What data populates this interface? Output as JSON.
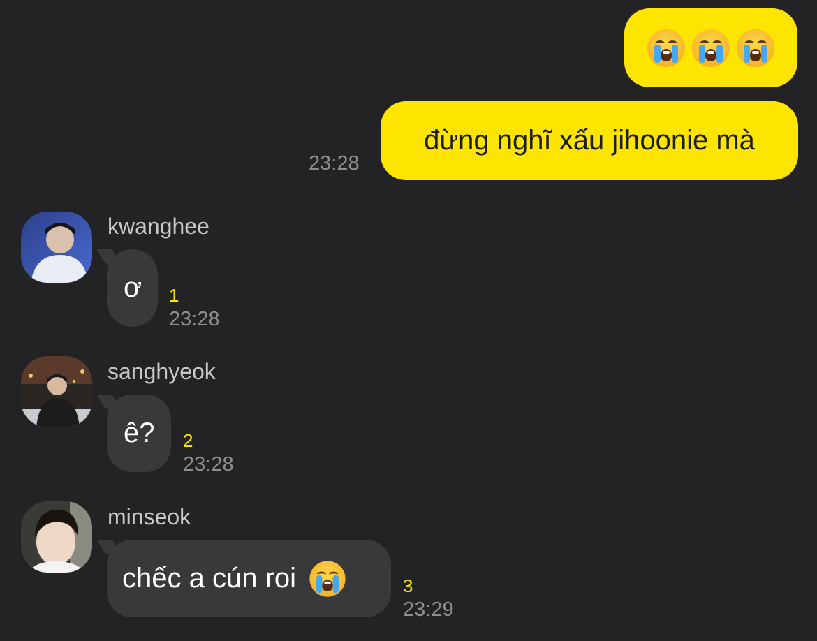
{
  "chat": {
    "outgoing": [
      {
        "emojis": [
          "loudly-crying-face-icon",
          "loudly-crying-face-icon",
          "loudly-crying-face-icon"
        ]
      },
      {
        "text": "đừng nghĩ xấu jihoonie mà",
        "time": "23:28"
      }
    ],
    "incoming": [
      {
        "sender": "kwanghee",
        "text": "ơ",
        "unread": "1",
        "time": "23:28"
      },
      {
        "sender": "sanghyeok",
        "text": "ê?",
        "unread": "2",
        "time": "23:28"
      },
      {
        "sender": "minseok",
        "text": "chếc a cún roi",
        "emoji": "loudly-crying-face-icon",
        "unread": "3",
        "time": "23:29"
      }
    ]
  },
  "colors": {
    "background": "#232325",
    "outgoing_bubble": "#fee500",
    "incoming_bubble": "#39393c",
    "unread": "#fee500",
    "timestamp": "#8e8e90"
  }
}
